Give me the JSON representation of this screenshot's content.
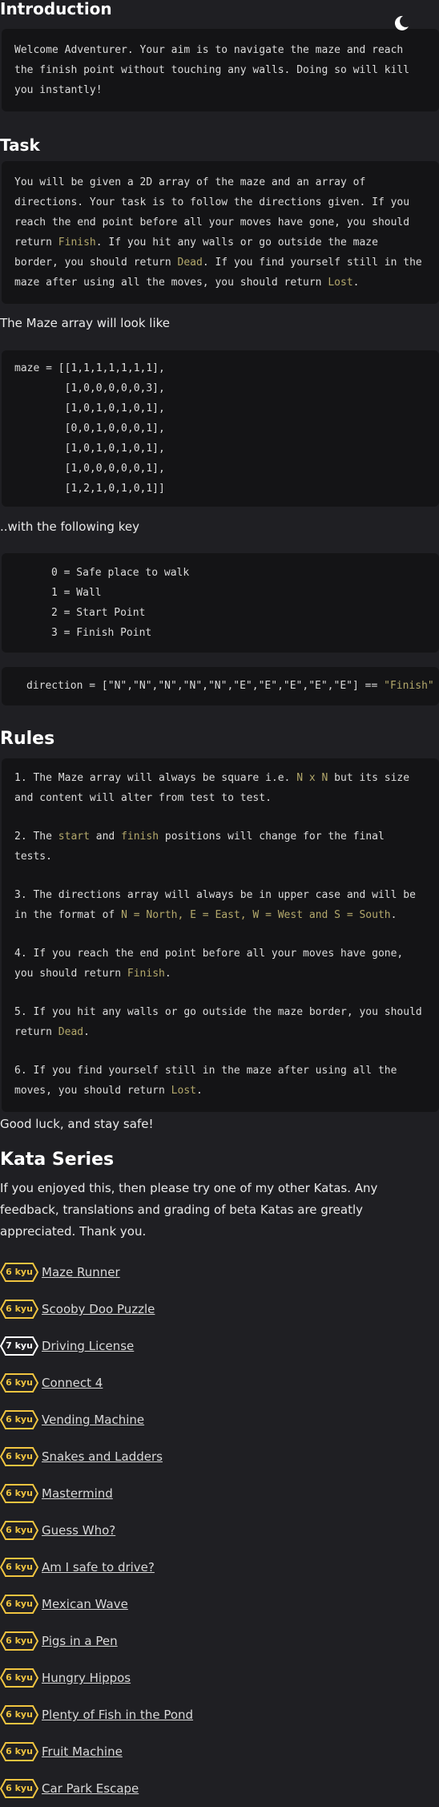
{
  "intro": {
    "title": "Introduction",
    "text": "Welcome Adventurer. Your aim is to navigate the maze and reach the finish point without touching any walls. Doing so will kill you instantly!"
  },
  "task": {
    "title": "Task",
    "text_a": "You will be given a 2D array of the maze and an array of directions. Your task is to follow the directions given. If you reach the end point before all your moves have gone, you should return ",
    "finish": "Finish",
    "text_b": ". If you hit any walls or go outside the maze border, you should return ",
    "dead": "Dead",
    "text_c": ". If you find yourself still in the maze after using all the moves, you should return ",
    "lost": "Lost",
    "text_d": "."
  },
  "maze": {
    "intro": "The Maze array will look like",
    "code": "maze = [[1,1,1,1,1,1,1],\n        [1,0,0,0,0,0,3],\n        [1,0,1,0,1,0,1],\n        [0,0,1,0,0,0,1],\n        [1,0,1,0,1,0,1],\n        [1,0,0,0,0,0,1],\n        [1,2,1,0,1,0,1]]"
  },
  "key": {
    "intro": "..with the following key",
    "code": "0 = Safe place to walk\n1 = Wall\n2 = Start Point\n3 = Finish Point"
  },
  "direction": {
    "code": "direction = [\"N\",\"N\",\"N\",\"N\",\"N\",\"E\",\"E\",\"E\",\"E\",\"E\"] == ",
    "result": "\"Finish\""
  },
  "rules": {
    "title": "Rules",
    "r1_a": "1. The Maze array will always be square i.e. ",
    "r1_hl": "N x N",
    "r1_b": " but its size and content will alter from test to test.",
    "r2_a": "2. The ",
    "r2_start": "start",
    "r2_b": " and ",
    "r2_finish": "finish",
    "r2_c": " positions will change for the final tests.",
    "r3_a": "3. The directions array will always be in upper case and will be in the format of ",
    "r3_hl": "N = North, E = East, W = West and S = South",
    "r3_b": ".",
    "r4_a": "4. If you reach the end point before all your moves have gone, you should return ",
    "r4_hl": "Finish",
    "r4_b": ".",
    "r5_a": "5. If you hit any walls or go outside the maze border, you should return ",
    "r5_hl": "Dead",
    "r5_b": ".",
    "r6_a": "6. If you find yourself still in the maze after using all the moves, you should return ",
    "r6_hl": "Lost",
    "r6_b": "."
  },
  "good_luck": "Good luck, and stay safe!",
  "series": {
    "title": "Kata Series",
    "text": "If you enjoyed this, then please try one of my other Katas. Any feedback, translations and grading of beta Katas are greatly appreciated. Thank you.",
    "items": [
      {
        "rank": "6 kyu",
        "name": "Maze Runner"
      },
      {
        "rank": "6 kyu",
        "name": "Scooby Doo Puzzle"
      },
      {
        "rank": "7 kyu",
        "name": "Driving License"
      },
      {
        "rank": "6 kyu",
        "name": "Connect 4"
      },
      {
        "rank": "6 kyu",
        "name": "Vending Machine"
      },
      {
        "rank": "6 kyu",
        "name": "Snakes and Ladders"
      },
      {
        "rank": "6 kyu",
        "name": "Mastermind"
      },
      {
        "rank": "6 kyu",
        "name": "Guess Who?"
      },
      {
        "rank": "6 kyu",
        "name": "Am I safe to drive?"
      },
      {
        "rank": "6 kyu",
        "name": "Mexican Wave"
      },
      {
        "rank": "6 kyu",
        "name": "Pigs in a Pen"
      },
      {
        "rank": "6 kyu",
        "name": "Hungry Hippos"
      },
      {
        "rank": "6 kyu",
        "name": "Plenty of Fish in the Pond"
      },
      {
        "rank": "6 kyu",
        "name": "Fruit Machine"
      },
      {
        "rank": "6 kyu",
        "name": "Car Park Escape"
      }
    ]
  },
  "colors": {
    "background": "#1f1f23",
    "code_background": "#141416",
    "highlight": "#b3a86b",
    "kyu6": "#f0c440",
    "kyu7": "#ffffff"
  },
  "icons": {
    "theme_toggle": "moon-icon"
  }
}
